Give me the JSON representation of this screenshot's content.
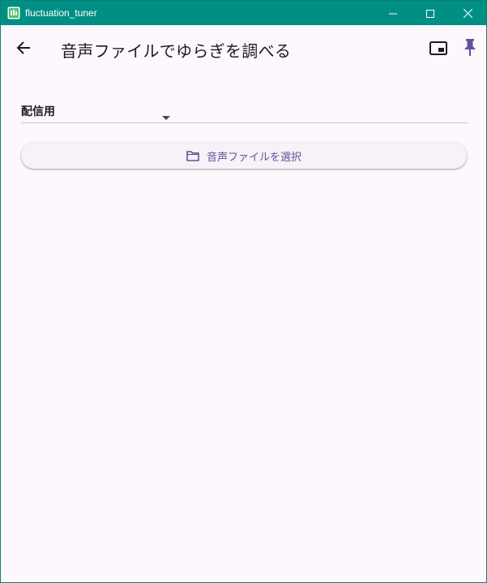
{
  "window": {
    "title": "fluctuation_tuner"
  },
  "appbar": {
    "title": "音声ファイルでゆらぎを調べる"
  },
  "dropdown": {
    "selected": "配信用"
  },
  "select_button": {
    "label": "音声ファイルを選択"
  },
  "icons": {
    "app": "app-icon",
    "minimize": "minimize-icon",
    "maximize": "maximize-icon",
    "close": "close-icon",
    "back": "arrow-back-icon",
    "pip": "picture-in-picture-icon",
    "pin": "pin-icon",
    "dropdown": "arrow-drop-down-icon",
    "folder": "folder-icon"
  },
  "colors": {
    "titlebar": "#008f85",
    "background": "#fdf7fe",
    "accent": "#66519d",
    "button_bg": "#f6f2f7"
  }
}
